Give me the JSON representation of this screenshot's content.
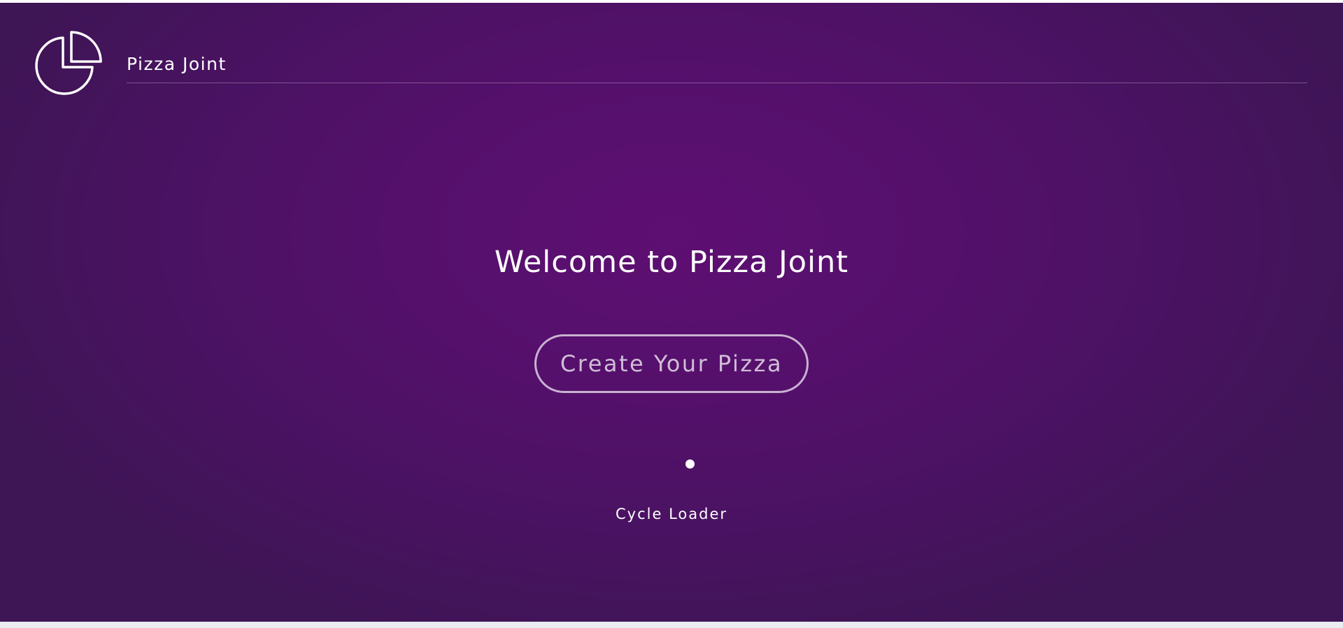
{
  "header": {
    "logo_icon": "pie-chart-icon",
    "brand_name": "Pizza Joint"
  },
  "main": {
    "title": "Welcome to Pizza Joint",
    "cta_label": "Create Your Pizza"
  },
  "loader": {
    "label": "Cycle Loader"
  },
  "colors": {
    "background_center": "#5e0f72",
    "background_edge": "#3e1555",
    "text": "#ffffff"
  }
}
